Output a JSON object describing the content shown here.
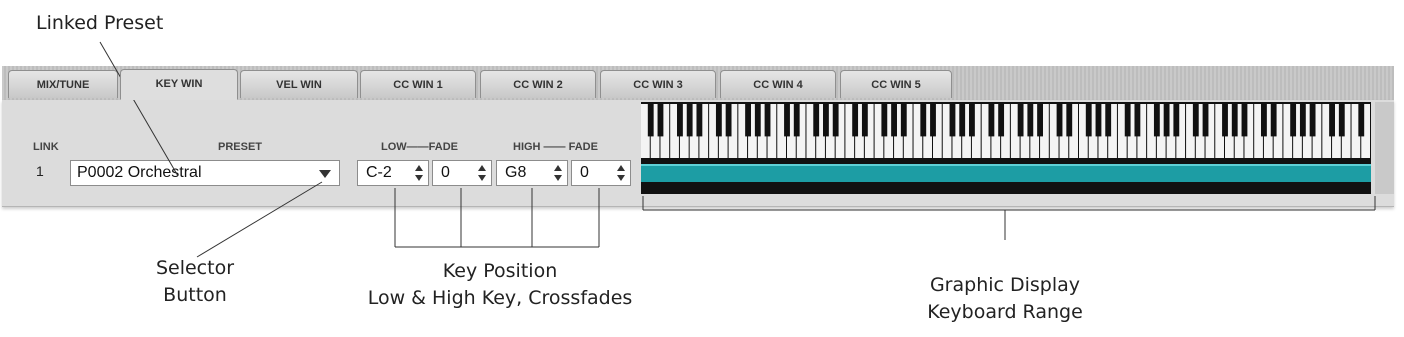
{
  "callouts": {
    "linked_preset": "Linked Preset",
    "selector_line1": "Selector",
    "selector_line2": "Button",
    "key_position_title": "Key Position",
    "key_position_sub": "Low & High Key, Crossfades",
    "graphic_line1": "Graphic Display",
    "graphic_line2": "Keyboard Range"
  },
  "tabs": [
    {
      "label": "MIX/TUNE",
      "active": false
    },
    {
      "label": "KEY WIN",
      "active": true
    },
    {
      "label": "VEL WIN",
      "active": false
    },
    {
      "label": "CC WIN 1",
      "active": false
    },
    {
      "label": "CC WIN 2",
      "active": false
    },
    {
      "label": "CC WIN 3",
      "active": false
    },
    {
      "label": "CC WIN 4",
      "active": false
    },
    {
      "label": "CC WIN 5",
      "active": false
    }
  ],
  "headers": {
    "link": "LINK",
    "preset": "PRESET",
    "low_fade": "LOW——FADE",
    "high_fade": "HIGH —— FADE"
  },
  "row": {
    "number": "1",
    "preset": "P0002 Orchestral",
    "low_key": "C-2",
    "low_fade": "0",
    "high_key": "G8",
    "high_fade": "0"
  },
  "colors": {
    "range_bar": "#1d9da4",
    "panel_bg": "#dcdcdc"
  },
  "keyboard": {
    "white_keys": 75,
    "range_fraction_low": 0.0,
    "range_fraction_high": 1.0
  }
}
